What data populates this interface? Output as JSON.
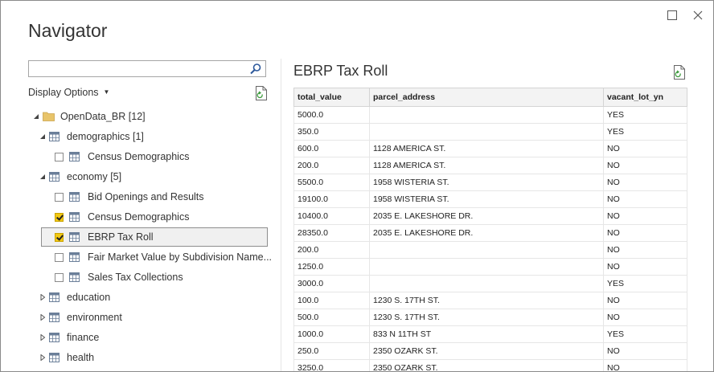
{
  "window": {
    "title": "Navigator"
  },
  "search": {
    "placeholder": "",
    "value": ""
  },
  "display_options": {
    "label": "Display Options"
  },
  "tree": [
    {
      "label": "OpenData_BR [12]",
      "level": 0,
      "type": "folder",
      "expanded": true
    },
    {
      "label": "demographics [1]",
      "level": 1,
      "type": "group",
      "expanded": true
    },
    {
      "label": "Census Demographics",
      "level": 2,
      "type": "table",
      "checked": false
    },
    {
      "label": "economy [5]",
      "level": 1,
      "type": "group",
      "expanded": true
    },
    {
      "label": "Bid Openings and Results",
      "level": 2,
      "type": "table",
      "checked": false
    },
    {
      "label": "Census Demographics",
      "level": 2,
      "type": "table",
      "checked": true
    },
    {
      "label": "EBRP Tax Roll",
      "level": 2,
      "type": "table",
      "checked": true,
      "selected": true
    },
    {
      "label": "Fair Market Value by Subdivision Name...",
      "level": 2,
      "type": "table",
      "checked": false
    },
    {
      "label": "Sales Tax Collections",
      "level": 2,
      "type": "table",
      "checked": false
    },
    {
      "label": "education",
      "level": 1,
      "type": "group",
      "expanded": false
    },
    {
      "label": "environment",
      "level": 1,
      "type": "group",
      "expanded": false
    },
    {
      "label": "finance",
      "level": 1,
      "type": "group",
      "expanded": false
    },
    {
      "label": "health",
      "level": 1,
      "type": "group",
      "expanded": false
    }
  ],
  "preview": {
    "title": "EBRP Tax Roll",
    "columns": [
      "total_value",
      "parcel_address",
      "vacant_lot_yn"
    ],
    "rows": [
      [
        "5000.0",
        "",
        "YES"
      ],
      [
        "350.0",
        "",
        "YES"
      ],
      [
        "600.0",
        "1128 AMERICA ST.",
        "NO"
      ],
      [
        "200.0",
        "1128 AMERICA ST.",
        "NO"
      ],
      [
        "5500.0",
        "1958 WISTERIA ST.",
        "NO"
      ],
      [
        "19100.0",
        "1958 WISTERIA ST.",
        "NO"
      ],
      [
        "10400.0",
        "2035 E. LAKESHORE DR.",
        "NO"
      ],
      [
        "28350.0",
        "2035 E. LAKESHORE DR.",
        "NO"
      ],
      [
        "200.0",
        "",
        "NO"
      ],
      [
        "1250.0",
        "",
        "NO"
      ],
      [
        "3000.0",
        "",
        "YES"
      ],
      [
        "100.0",
        "1230 S. 17TH ST.",
        "NO"
      ],
      [
        "500.0",
        "1230 S. 17TH ST.",
        "NO"
      ],
      [
        "1000.0",
        "833 N 11TH ST",
        "YES"
      ],
      [
        "250.0",
        "2350 OZARK ST.",
        "NO"
      ],
      [
        "3250.0",
        "2350 OZARK ST.",
        "NO"
      ]
    ]
  },
  "colors": {
    "checkbox_checked": "#f2c811",
    "folder": "#e8c46a",
    "table_icon": "#6b7f99"
  },
  "icons": {
    "search": "search-icon",
    "refresh": "refresh-icon",
    "folder": "folder-icon",
    "table": "table-icon"
  }
}
